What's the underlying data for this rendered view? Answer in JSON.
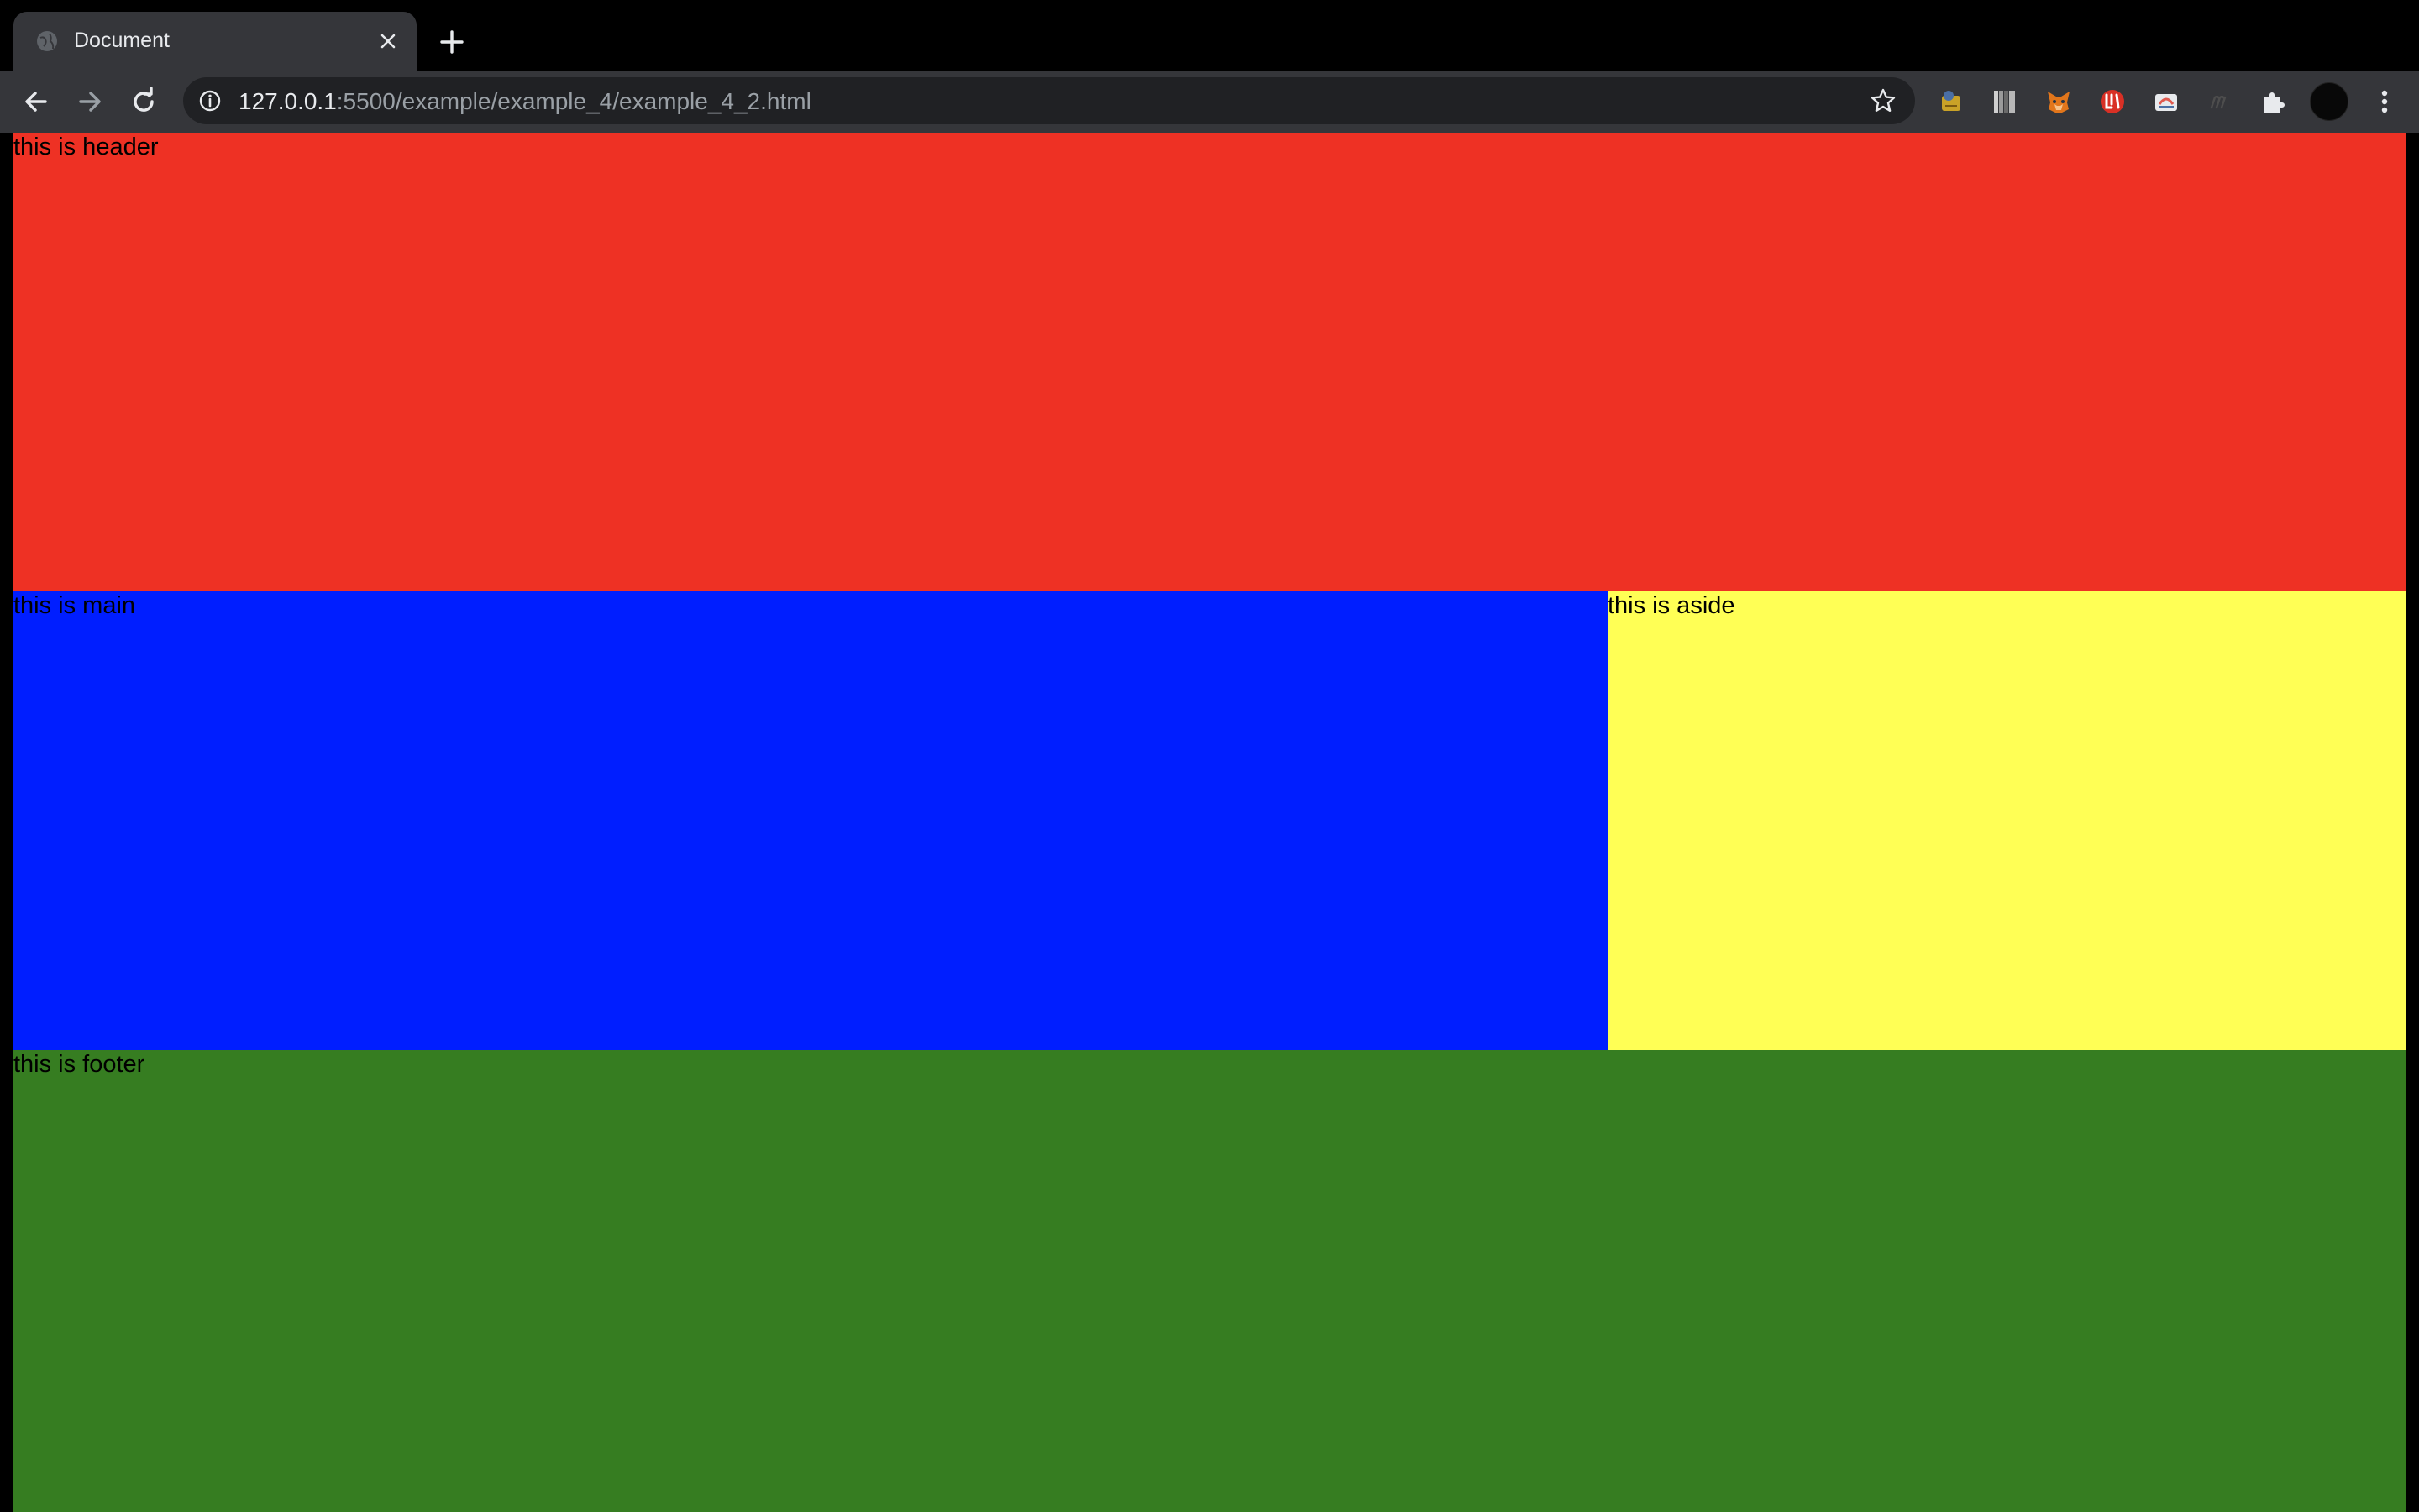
{
  "browser": {
    "tab": {
      "title": "Document",
      "favicon": "globe-icon",
      "close_icon": "close-icon"
    },
    "new_tab_icon": "plus-icon",
    "toolbar": {
      "back_icon": "back-arrow-icon",
      "forward_icon": "forward-arrow-icon",
      "reload_icon": "reload-icon",
      "info_icon": "info-icon",
      "url_host": "127.0.0.1",
      "url_path": ":5500/example/example_4/example_4_2.html",
      "bookmark_icon": "star-icon",
      "extensions": [
        "extension-icon-1",
        "extension-icon-2",
        "metamask-fox-icon",
        "extension-icon-red",
        "extension-icon-4",
        "extension-icon-5",
        "puzzle-icon"
      ],
      "profile": "avatar",
      "menu_icon": "kebab-menu-icon"
    }
  },
  "page": {
    "header": {
      "text": "this is header",
      "color": "#ee3124"
    },
    "main": {
      "text": "this is main",
      "color": "#001eff"
    },
    "aside": {
      "text": "this is aside",
      "color": "#ffff55"
    },
    "footer": {
      "text": "this is footer",
      "color": "#367d21"
    }
  }
}
